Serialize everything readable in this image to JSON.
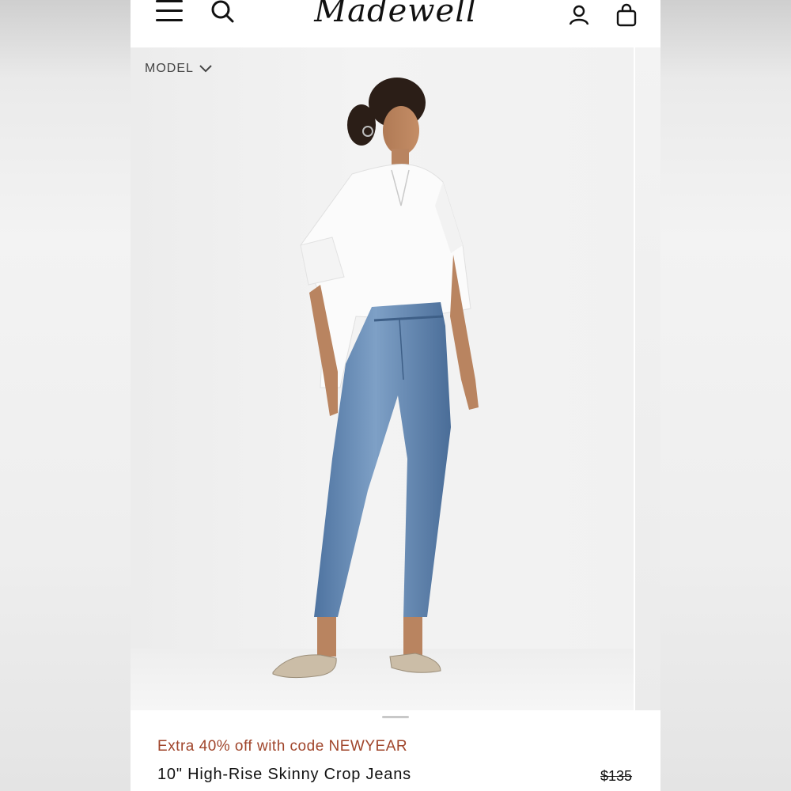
{
  "header": {
    "logo_text": "Madewell",
    "menu_icon": "hamburger-menu-icon",
    "search_icon": "search-icon",
    "account_icon": "account-icon",
    "bag_icon": "shopping-bag-icon"
  },
  "gallery": {
    "model_toggle_label": "MODEL",
    "chevron_icon": "chevron-down-icon"
  },
  "product": {
    "promo": "Extra 40% off with code NEWYEAR",
    "name": "10\" High-Rise Skinny Crop Jeans",
    "price": "$135"
  },
  "colors": {
    "promo_text": "#a0452b",
    "denim": "#5b7fa8",
    "shirt": "#fafafa"
  }
}
